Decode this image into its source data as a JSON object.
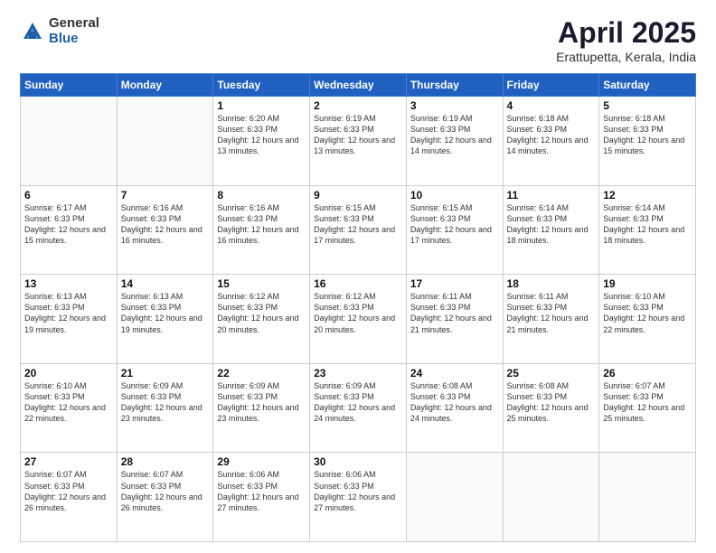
{
  "header": {
    "logo_general": "General",
    "logo_blue": "Blue",
    "title": "April 2025",
    "location": "Erattupetta, Kerala, India"
  },
  "days_of_week": [
    "Sunday",
    "Monday",
    "Tuesday",
    "Wednesday",
    "Thursday",
    "Friday",
    "Saturday"
  ],
  "weeks": [
    [
      {
        "day": "",
        "sunrise": "",
        "sunset": "",
        "daylight": ""
      },
      {
        "day": "",
        "sunrise": "",
        "sunset": "",
        "daylight": ""
      },
      {
        "day": "1",
        "sunrise": "Sunrise: 6:20 AM",
        "sunset": "Sunset: 6:33 PM",
        "daylight": "Daylight: 12 hours and 13 minutes."
      },
      {
        "day": "2",
        "sunrise": "Sunrise: 6:19 AM",
        "sunset": "Sunset: 6:33 PM",
        "daylight": "Daylight: 12 hours and 13 minutes."
      },
      {
        "day": "3",
        "sunrise": "Sunrise: 6:19 AM",
        "sunset": "Sunset: 6:33 PM",
        "daylight": "Daylight: 12 hours and 14 minutes."
      },
      {
        "day": "4",
        "sunrise": "Sunrise: 6:18 AM",
        "sunset": "Sunset: 6:33 PM",
        "daylight": "Daylight: 12 hours and 14 minutes."
      },
      {
        "day": "5",
        "sunrise": "Sunrise: 6:18 AM",
        "sunset": "Sunset: 6:33 PM",
        "daylight": "Daylight: 12 hours and 15 minutes."
      }
    ],
    [
      {
        "day": "6",
        "sunrise": "Sunrise: 6:17 AM",
        "sunset": "Sunset: 6:33 PM",
        "daylight": "Daylight: 12 hours and 15 minutes."
      },
      {
        "day": "7",
        "sunrise": "Sunrise: 6:16 AM",
        "sunset": "Sunset: 6:33 PM",
        "daylight": "Daylight: 12 hours and 16 minutes."
      },
      {
        "day": "8",
        "sunrise": "Sunrise: 6:16 AM",
        "sunset": "Sunset: 6:33 PM",
        "daylight": "Daylight: 12 hours and 16 minutes."
      },
      {
        "day": "9",
        "sunrise": "Sunrise: 6:15 AM",
        "sunset": "Sunset: 6:33 PM",
        "daylight": "Daylight: 12 hours and 17 minutes."
      },
      {
        "day": "10",
        "sunrise": "Sunrise: 6:15 AM",
        "sunset": "Sunset: 6:33 PM",
        "daylight": "Daylight: 12 hours and 17 minutes."
      },
      {
        "day": "11",
        "sunrise": "Sunrise: 6:14 AM",
        "sunset": "Sunset: 6:33 PM",
        "daylight": "Daylight: 12 hours and 18 minutes."
      },
      {
        "day": "12",
        "sunrise": "Sunrise: 6:14 AM",
        "sunset": "Sunset: 6:33 PM",
        "daylight": "Daylight: 12 hours and 18 minutes."
      }
    ],
    [
      {
        "day": "13",
        "sunrise": "Sunrise: 6:13 AM",
        "sunset": "Sunset: 6:33 PM",
        "daylight": "Daylight: 12 hours and 19 minutes."
      },
      {
        "day": "14",
        "sunrise": "Sunrise: 6:13 AM",
        "sunset": "Sunset: 6:33 PM",
        "daylight": "Daylight: 12 hours and 19 minutes."
      },
      {
        "day": "15",
        "sunrise": "Sunrise: 6:12 AM",
        "sunset": "Sunset: 6:33 PM",
        "daylight": "Daylight: 12 hours and 20 minutes."
      },
      {
        "day": "16",
        "sunrise": "Sunrise: 6:12 AM",
        "sunset": "Sunset: 6:33 PM",
        "daylight": "Daylight: 12 hours and 20 minutes."
      },
      {
        "day": "17",
        "sunrise": "Sunrise: 6:11 AM",
        "sunset": "Sunset: 6:33 PM",
        "daylight": "Daylight: 12 hours and 21 minutes."
      },
      {
        "day": "18",
        "sunrise": "Sunrise: 6:11 AM",
        "sunset": "Sunset: 6:33 PM",
        "daylight": "Daylight: 12 hours and 21 minutes."
      },
      {
        "day": "19",
        "sunrise": "Sunrise: 6:10 AM",
        "sunset": "Sunset: 6:33 PM",
        "daylight": "Daylight: 12 hours and 22 minutes."
      }
    ],
    [
      {
        "day": "20",
        "sunrise": "Sunrise: 6:10 AM",
        "sunset": "Sunset: 6:33 PM",
        "daylight": "Daylight: 12 hours and 22 minutes."
      },
      {
        "day": "21",
        "sunrise": "Sunrise: 6:09 AM",
        "sunset": "Sunset: 6:33 PM",
        "daylight": "Daylight: 12 hours and 23 minutes."
      },
      {
        "day": "22",
        "sunrise": "Sunrise: 6:09 AM",
        "sunset": "Sunset: 6:33 PM",
        "daylight": "Daylight: 12 hours and 23 minutes."
      },
      {
        "day": "23",
        "sunrise": "Sunrise: 6:09 AM",
        "sunset": "Sunset: 6:33 PM",
        "daylight": "Daylight: 12 hours and 24 minutes."
      },
      {
        "day": "24",
        "sunrise": "Sunrise: 6:08 AM",
        "sunset": "Sunset: 6:33 PM",
        "daylight": "Daylight: 12 hours and 24 minutes."
      },
      {
        "day": "25",
        "sunrise": "Sunrise: 6:08 AM",
        "sunset": "Sunset: 6:33 PM",
        "daylight": "Daylight: 12 hours and 25 minutes."
      },
      {
        "day": "26",
        "sunrise": "Sunrise: 6:07 AM",
        "sunset": "Sunset: 6:33 PM",
        "daylight": "Daylight: 12 hours and 25 minutes."
      }
    ],
    [
      {
        "day": "27",
        "sunrise": "Sunrise: 6:07 AM",
        "sunset": "Sunset: 6:33 PM",
        "daylight": "Daylight: 12 hours and 26 minutes."
      },
      {
        "day": "28",
        "sunrise": "Sunrise: 6:07 AM",
        "sunset": "Sunset: 6:33 PM",
        "daylight": "Daylight: 12 hours and 26 minutes."
      },
      {
        "day": "29",
        "sunrise": "Sunrise: 6:06 AM",
        "sunset": "Sunset: 6:33 PM",
        "daylight": "Daylight: 12 hours and 27 minutes."
      },
      {
        "day": "30",
        "sunrise": "Sunrise: 6:06 AM",
        "sunset": "Sunset: 6:33 PM",
        "daylight": "Daylight: 12 hours and 27 minutes."
      },
      {
        "day": "",
        "sunrise": "",
        "sunset": "",
        "daylight": ""
      },
      {
        "day": "",
        "sunrise": "",
        "sunset": "",
        "daylight": ""
      },
      {
        "day": "",
        "sunrise": "",
        "sunset": "",
        "daylight": ""
      }
    ]
  ]
}
